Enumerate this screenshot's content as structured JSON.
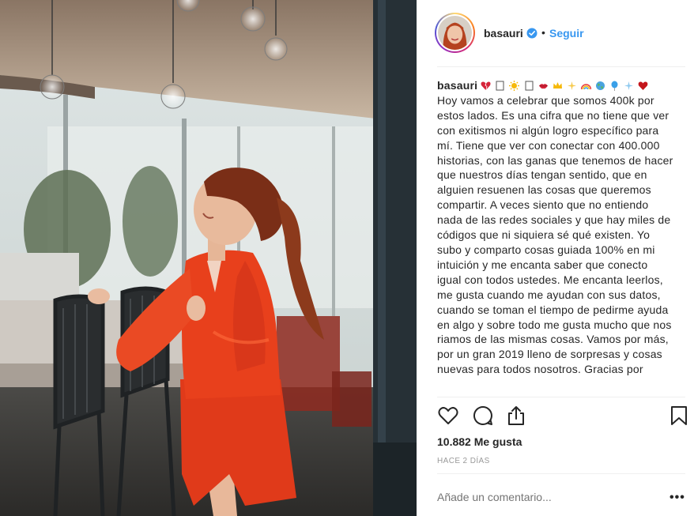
{
  "post": {
    "username": "basauri",
    "follow_label": "Seguir",
    "separator": "•",
    "caption_user": "basauri",
    "caption_emojis": [
      "broken-heart",
      "box",
      "sun",
      "box",
      "lips",
      "crown",
      "sparkles",
      "rainbow",
      "globe",
      "balloon",
      "sparkle",
      "heart"
    ],
    "caption_text": "Hoy vamos a celebrar que somos 400k por estos lados. Es una cifra que no tiene que ver con exitismos ni algún logro específico para mí. Tiene que ver con conectar con 400.000 historias, con las ganas que tenemos de hacer que nuestros días tengan sentido, que en alguien resuenen las cosas que queremos compartir. A veces siento que no entiendo nada de las redes sociales y que hay miles de códigos que ni siquiera sé qué existen. Yo subo y comparto cosas guiada 100% en mi intuición y me encanta saber que conecto igual con todos ustedes. Me encanta leerlos, me gusta cuando me ayudan con sus datos, cuando se toman el tiempo de pedirme ayuda en algo y sobre todo me gusta mucho que nos riamos de las mismas cosas. Vamos por más, por un gran 2019 lleno de sorpresas y cosas nuevas para todos nosotros. Gracias por",
    "likes": "10.882 Me gusta",
    "time": "HACE 2 DÍAS",
    "comment_placeholder": "Añade un comentario...",
    "more_label": "•••"
  },
  "icons": {
    "verified": "verified-badge-icon",
    "like": "heart-outline-icon",
    "comment": "speech-bubble-icon",
    "share": "share-upload-icon",
    "save": "bookmark-icon",
    "more": "more-dots-icon"
  },
  "colors": {
    "accent": "#3897f0",
    "text": "#262626",
    "muted": "#999999",
    "divider": "#efefef",
    "dress": "#e8401c"
  }
}
